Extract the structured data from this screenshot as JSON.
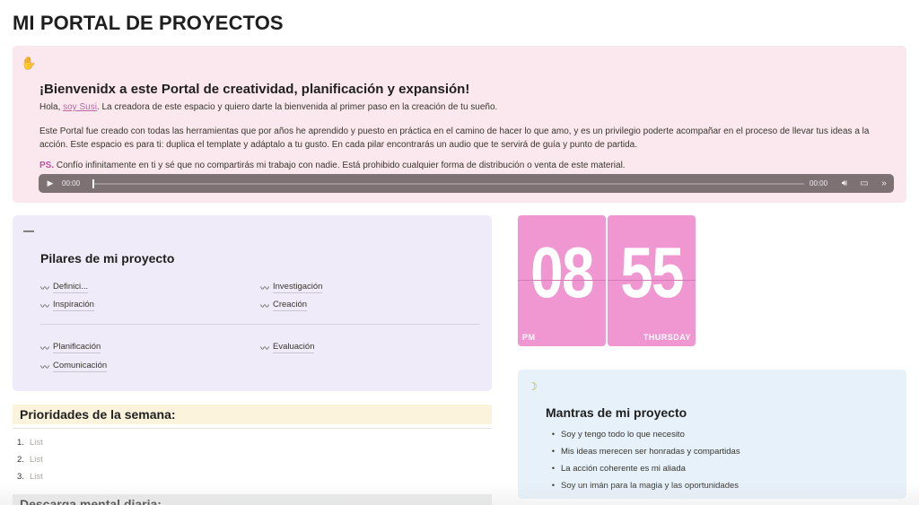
{
  "page_title": "MI PORTAL DE PROYECTOS",
  "welcome": {
    "icon": "raised-hand-icon",
    "heading": "¡Bienvenidx a este Portal de creatividad, planificación y expansión!",
    "p1_before": "Hola, ",
    "p1_link": "soy Susi",
    "p1_after": ". La creadora de este espacio y quiero darte la bienvenida al primer paso en la creación de tu sueño.",
    "p2": "Este Portal fue creado con todas las herramientas que por años he aprendido y puesto en práctica en el camino de hacer lo que amo, y es un privilegio poderte acompañar en el proceso de llevar tus ideas a la acción. Este espacio es para ti: duplica el template y adáptalo a tu gusto. En cada pilar encontrarás un audio que te servirá de guía y punto de partida.",
    "ps_label": "PS.",
    "ps_text": " Confío infinitamente en ti y sé que no compartirás mi trabajo con nadie. Está prohibido cualquier forma de distribución o venta de este material.",
    "audio": {
      "current_time": "00:00",
      "duration": "00:00",
      "progress": 0
    }
  },
  "pilares": {
    "icon": "dash-icon",
    "heading": "Pilares de mi proyecto",
    "items_top": [
      {
        "label": "Definici..."
      },
      {
        "label": "Investigación"
      },
      {
        "label": "Inspiración"
      },
      {
        "label": "Creación"
      }
    ],
    "items_bottom": [
      {
        "label": "Planificación"
      },
      {
        "label": "Evaluación"
      },
      {
        "label": "Comunicación"
      }
    ]
  },
  "clock": {
    "hours": "08",
    "minutes": "55",
    "period": "PM",
    "day": "THURSDAY",
    "color": "#f096d0"
  },
  "mantras": {
    "icon": "crescent-moon-icon",
    "heading": "Mantras de mi proyecto",
    "items": [
      "Soy y tengo todo lo que necesito",
      "Mis ideas merecen ser honradas y compartidas",
      "La acción coherente es mi aliada",
      "Soy un imán para la magia y las oportunidades"
    ]
  },
  "prioridades": {
    "heading": "Prioridades de la semana:",
    "items": [
      {
        "num": "1.",
        "placeholder": "List"
      },
      {
        "num": "2.",
        "placeholder": "List"
      },
      {
        "num": "3.",
        "placeholder": "List"
      }
    ]
  },
  "descarga": {
    "heading": "Descarga mental diaria:"
  }
}
